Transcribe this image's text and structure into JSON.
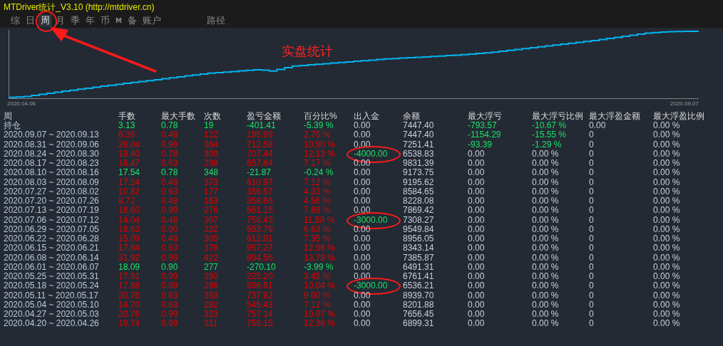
{
  "window": {
    "title": "MTDriver统计_V3.10 (http://mtdriver.cn)"
  },
  "tabs": [
    {
      "label": "综",
      "selected": false,
      "circled": false
    },
    {
      "label": "日",
      "selected": false,
      "circled": false
    },
    {
      "label": "周",
      "selected": true,
      "circled": true
    },
    {
      "label": "月",
      "selected": false,
      "circled": false
    },
    {
      "label": "季",
      "selected": false,
      "circled": false
    },
    {
      "label": "年",
      "selected": false,
      "circled": false
    },
    {
      "label": "币",
      "selected": false,
      "circled": false
    },
    {
      "label": "M",
      "selected": false,
      "circled": false,
      "kind": "small"
    },
    {
      "label": "备",
      "selected": false,
      "circled": false
    },
    {
      "label": "账户",
      "selected": false,
      "circled": false
    }
  ],
  "path_tab": "路径",
  "chart": {
    "annotation": "实盘统计",
    "start_label": "2020.04.06",
    "end_label": "2020.09.07"
  },
  "table": {
    "columns": [
      "周",
      "手数",
      "最大手数",
      "次数",
      "盈亏金额",
      "百分比%",
      "出入金",
      "余额",
      "最大浮亏",
      "最大浮亏比例",
      "最大浮盈金额",
      "最大浮盈比例"
    ],
    "rows": [
      {
        "cells": [
          "持仓",
          "3.13",
          "0.78",
          "19",
          "-401.41",
          "-5.39 %",
          "0.00",
          "7447.40",
          "-793.57",
          "-10.67 %",
          "0.00",
          "0.00 %"
        ],
        "loss": true,
        "flow_out": false,
        "float_loss": true,
        "circled": false
      },
      {
        "cells": [
          "2020.09.07 ~ 2020.09.13",
          "6.36",
          "0.48",
          "122",
          "195.99",
          "2.70 %",
          "0.00",
          "7447.40",
          "-1154.29",
          "-15.55 %",
          "0",
          "0.00 %"
        ],
        "loss": false,
        "flow_out": false,
        "float_loss": true,
        "circled": false
      },
      {
        "cells": [
          "2020.08.31 ~ 2020.09.06",
          "26.04",
          "0.99",
          "364",
          "712.58",
          "10.90 %",
          "0.00",
          "7251.41",
          "-93.39",
          "-1.29 %",
          "0",
          "0.00 %"
        ],
        "loss": false,
        "flow_out": false,
        "float_loss": true,
        "circled": false
      },
      {
        "cells": [
          "2020.08.24 ~ 2020.08.30",
          "19.40",
          "0.78",
          "309",
          "707.44",
          "12.13 %",
          "-4000.00",
          "6538.83",
          "0.00",
          "0.00 %",
          "0",
          "0.00 %"
        ],
        "loss": false,
        "flow_out": true,
        "float_loss": false,
        "circled": true
      },
      {
        "cells": [
          "2020.08.17 ~ 2020.08.23",
          "18.47",
          "0.63",
          "298",
          "657.64",
          "7.17 %",
          "0.00",
          "9831.39",
          "0.00",
          "0.00 %",
          "0",
          "0.00 %"
        ],
        "loss": false,
        "flow_out": false,
        "float_loss": false,
        "circled": false
      },
      {
        "cells": [
          "2020.08.10 ~ 2020.08.16",
          "17.54",
          "0.78",
          "348",
          "-21.87",
          "-0.24 %",
          "0.00",
          "9173.75",
          "0.00",
          "0.00 %",
          "0",
          "0.00 %"
        ],
        "loss": true,
        "flow_out": false,
        "float_loss": false,
        "circled": false
      },
      {
        "cells": [
          "2020.08.03 ~ 2020.08.09",
          "17.24",
          "0.48",
          "373",
          "610.97",
          "7.12 %",
          "0.00",
          "9195.62",
          "0.00",
          "0.00 %",
          "0",
          "0.00 %"
        ],
        "loss": false,
        "flow_out": false,
        "float_loss": false,
        "circled": false
      },
      {
        "cells": [
          "2020.07.27 ~ 2020.08.02",
          "10.82",
          "0.63",
          "177",
          "356.57",
          "4.33 %",
          "0.00",
          "8584.65",
          "0.00",
          "0.00 %",
          "0",
          "0.00 %"
        ],
        "loss": false,
        "flow_out": false,
        "float_loss": false,
        "circled": false
      },
      {
        "cells": [
          "2020.07.20 ~ 2020.07.26",
          "8.72",
          "0.48",
          "163",
          "358.66",
          "4.56 %",
          "0.00",
          "8228.08",
          "0.00",
          "0.00 %",
          "0",
          "0.00 %"
        ],
        "loss": false,
        "flow_out": false,
        "float_loss": false,
        "circled": false
      },
      {
        "cells": [
          "2020.07.13 ~ 2020.07.19",
          "18.60",
          "0.99",
          "276",
          "561.15",
          "7.68 %",
          "0.00",
          "7869.42",
          "0.00",
          "0.00 %",
          "0",
          "0.00 %"
        ],
        "loss": false,
        "flow_out": false,
        "float_loss": false,
        "circled": false
      },
      {
        "cells": [
          "2020.07.06 ~ 2020.07.12",
          "14.04",
          "0.48",
          "307",
          "758.43",
          "11.58 %",
          "-3000.00",
          "7308.27",
          "0.00",
          "0.00 %",
          "0",
          "0.00 %"
        ],
        "loss": false,
        "flow_out": true,
        "float_loss": false,
        "circled": true
      },
      {
        "cells": [
          "2020.06.29 ~ 2020.07.05",
          "18.63",
          "0.90",
          "332",
          "593.79",
          "6.63 %",
          "0.00",
          "9549.84",
          "0.00",
          "0.00 %",
          "0",
          "0.00 %"
        ],
        "loss": false,
        "flow_out": false,
        "float_loss": false,
        "circled": false
      },
      {
        "cells": [
          "2020.06.22 ~ 2020.06.28",
          "15.09",
          "0.48",
          "305",
          "612.91",
          "7.35 %",
          "0.00",
          "8956.05",
          "0.00",
          "0.00 %",
          "0",
          "0.00 %"
        ],
        "loss": false,
        "flow_out": false,
        "float_loss": false,
        "circled": false
      },
      {
        "cells": [
          "2020.06.15 ~ 2020.06.21",
          "17.94",
          "0.63",
          "378",
          "957.27",
          "12.96 %",
          "0.00",
          "8343.14",
          "0.00",
          "0.00 %",
          "0",
          "0.00 %"
        ],
        "loss": false,
        "flow_out": false,
        "float_loss": false,
        "circled": false
      },
      {
        "cells": [
          "2020.06.08 ~ 2020.06.14",
          "31.92",
          "0.99",
          "422",
          "894.56",
          "13.78 %",
          "0.00",
          "7385.87",
          "0.00",
          "0.00 %",
          "0",
          "0.00 %"
        ],
        "loss": false,
        "flow_out": false,
        "float_loss": false,
        "circled": false
      },
      {
        "cells": [
          "2020.06.01 ~ 2020.06.07",
          "18.09",
          "0.90",
          "277",
          "-270.10",
          "-3.99 %",
          "0.00",
          "6491.31",
          "0.00",
          "0.00 %",
          "0",
          "0.00 %"
        ],
        "loss": true,
        "flow_out": false,
        "float_loss": false,
        "circled": false
      },
      {
        "cells": [
          "2020.05.25 ~ 2020.05.31",
          "17.91",
          "0.99",
          "250",
          "225.20",
          "3.45 %",
          "0.00",
          "6761.41",
          "0.00",
          "0.00 %",
          "0",
          "0.00 %"
        ],
        "loss": false,
        "flow_out": false,
        "float_loss": false,
        "circled": false
      },
      {
        "cells": [
          "2020.05.18 ~ 2020.05.24",
          "17.88",
          "0.99",
          "296",
          "596.51",
          "10.04 %",
          "-3000.00",
          "6536.21",
          "0.00",
          "0.00 %",
          "0",
          "0.00 %"
        ],
        "loss": false,
        "flow_out": true,
        "float_loss": false,
        "circled": true
      },
      {
        "cells": [
          "2020.05.11 ~ 2020.05.17",
          "20.76",
          "0.63",
          "353",
          "737.82",
          "9.00 %",
          "0.00",
          "8939.70",
          "0.00",
          "0.00 %",
          "0",
          "0.00 %"
        ],
        "loss": false,
        "flow_out": false,
        "float_loss": false,
        "circled": false
      },
      {
        "cells": [
          "2020.05.04 ~ 2020.05.10",
          "14.70",
          "0.63",
          "282",
          "545.43",
          "7.12 %",
          "0.00",
          "8201.88",
          "0.00",
          "0.00 %",
          "0",
          "0.00 %"
        ],
        "loss": false,
        "flow_out": false,
        "float_loss": false,
        "circled": false
      },
      {
        "cells": [
          "2020.04.27 ~ 2020.05.03",
          "20.76",
          "0.99",
          "323",
          "757.14",
          "10.97 %",
          "0.00",
          "7656.45",
          "0.00",
          "0.00 %",
          "0",
          "0.00 %"
        ],
        "loss": false,
        "flow_out": false,
        "float_loss": false,
        "circled": false
      },
      {
        "cells": [
          "2020.04.20 ~ 2020.04.26",
          "19.74",
          "0.99",
          "311",
          "759.15",
          "12.36 %",
          "0.00",
          "6899.31",
          "0.00",
          "0.00 %",
          "0",
          "0.00 %"
        ],
        "loss": false,
        "flow_out": false,
        "float_loss": false,
        "circled": false
      }
    ]
  }
}
